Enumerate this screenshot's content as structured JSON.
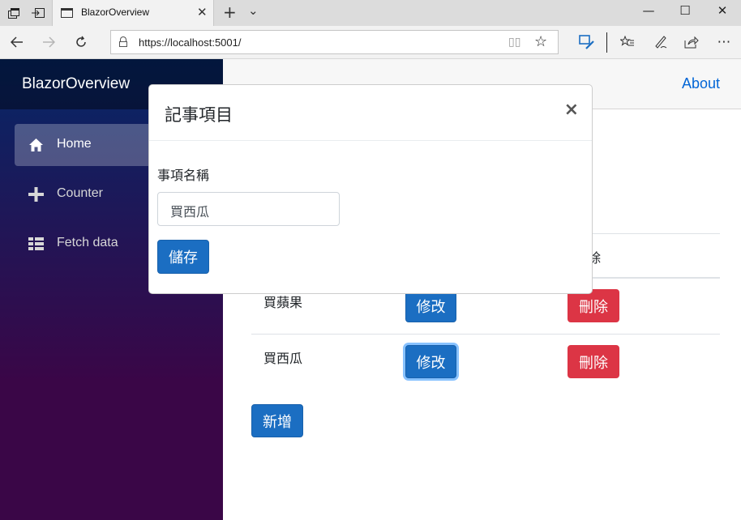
{
  "browser": {
    "tab_title": "BlazorOverview",
    "url": "https://localhost:5001/"
  },
  "app": {
    "brand": "BlazorOverview",
    "about_link": "About",
    "nav": [
      {
        "label": "Home",
        "icon": "home-icon",
        "active": true
      },
      {
        "label": "Counter",
        "icon": "plus-icon",
        "active": false
      },
      {
        "label": "Fetch data",
        "icon": "list-icon",
        "active": false
      }
    ]
  },
  "table": {
    "header_partial": "除",
    "rows": [
      {
        "name": "買蘋果",
        "edit_label": "修改",
        "delete_label": "刪除"
      },
      {
        "name": "買西瓜",
        "edit_label": "修改",
        "delete_label": "刪除"
      }
    ],
    "add_label": "新增"
  },
  "modal": {
    "title": "記事項目",
    "close_glyph": "×",
    "field_label": "事項名稱",
    "field_value": "買西瓜",
    "save_label": "儲存"
  },
  "colors": {
    "primary": "#1b6ec2",
    "danger": "#dc3545",
    "link": "#0366d6",
    "sidebar_top": "#052767",
    "sidebar_bottom": "#3a0647"
  }
}
